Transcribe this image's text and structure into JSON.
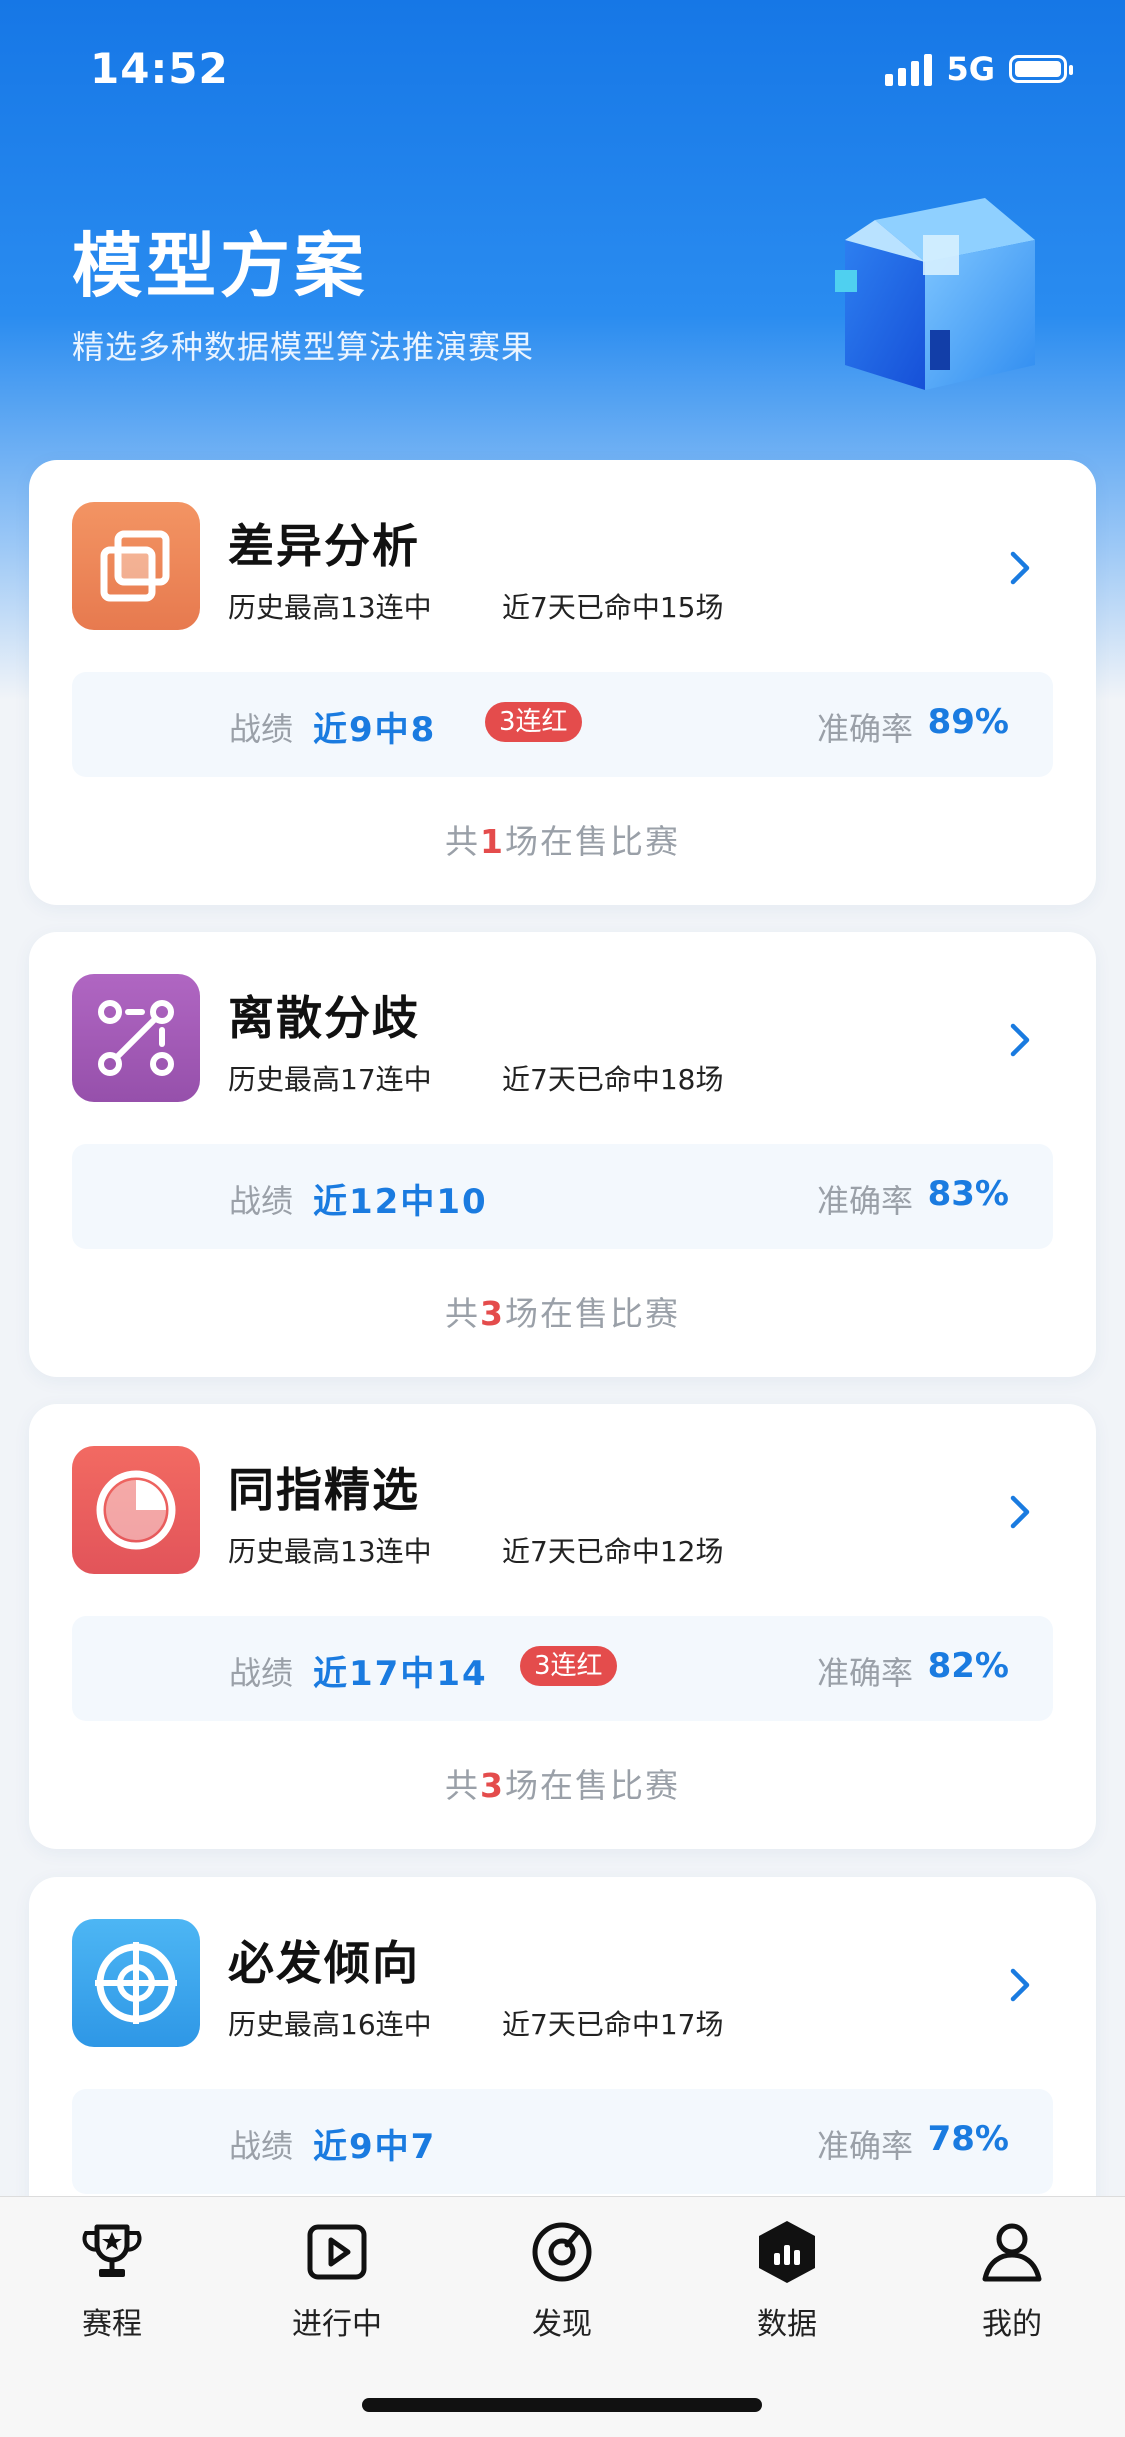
{
  "status_bar": {
    "time": "14:52",
    "network": "5G"
  },
  "header": {
    "title": "模型方案",
    "subtitle": "精选多种数据模型算法推演赛果"
  },
  "labels": {
    "record": "战绩",
    "accuracy": "准确率"
  },
  "models": [
    {
      "name": "差异分析",
      "history": "历史最高13连中",
      "recent": "近7天已命中15场",
      "record": "近9中8",
      "streak": "3连红",
      "accuracy": "89%",
      "sale_prefix": "共",
      "sale_count": "1",
      "sale_suffix": "场在售比赛",
      "icon": "overlap-squares-icon",
      "color": "#f08a55"
    },
    {
      "name": "离散分歧",
      "history": "历史最高17连中",
      "recent": "近7天已命中18场",
      "record": "近12中10",
      "streak": "",
      "accuracy": "83%",
      "sale_prefix": "共",
      "sale_count": "3",
      "sale_suffix": "场在售比赛",
      "icon": "scatter-dots-icon",
      "color": "#a25ab8"
    },
    {
      "name": "同指精选",
      "history": "历史最高13连中",
      "recent": "近7天已命中12场",
      "record": "近17中14",
      "streak": "3连红",
      "accuracy": "82%",
      "sale_prefix": "共",
      "sale_count": "3",
      "sale_suffix": "场在售比赛",
      "icon": "pie-chart-icon",
      "color": "#ec5f60"
    },
    {
      "name": "必发倾向",
      "history": "历史最高16连中",
      "recent": "近7天已命中17场",
      "record": "近9中7",
      "streak": "",
      "accuracy": "78%",
      "icon": "target-icon",
      "color": "#3aa5ee"
    }
  ],
  "tabs": [
    {
      "label": "赛程",
      "icon": "trophy-icon"
    },
    {
      "label": "进行中",
      "icon": "play-icon"
    },
    {
      "label": "发现",
      "icon": "compass-icon"
    },
    {
      "label": "数据",
      "icon": "data-hex-icon",
      "active": true
    },
    {
      "label": "我的",
      "icon": "user-icon"
    }
  ]
}
